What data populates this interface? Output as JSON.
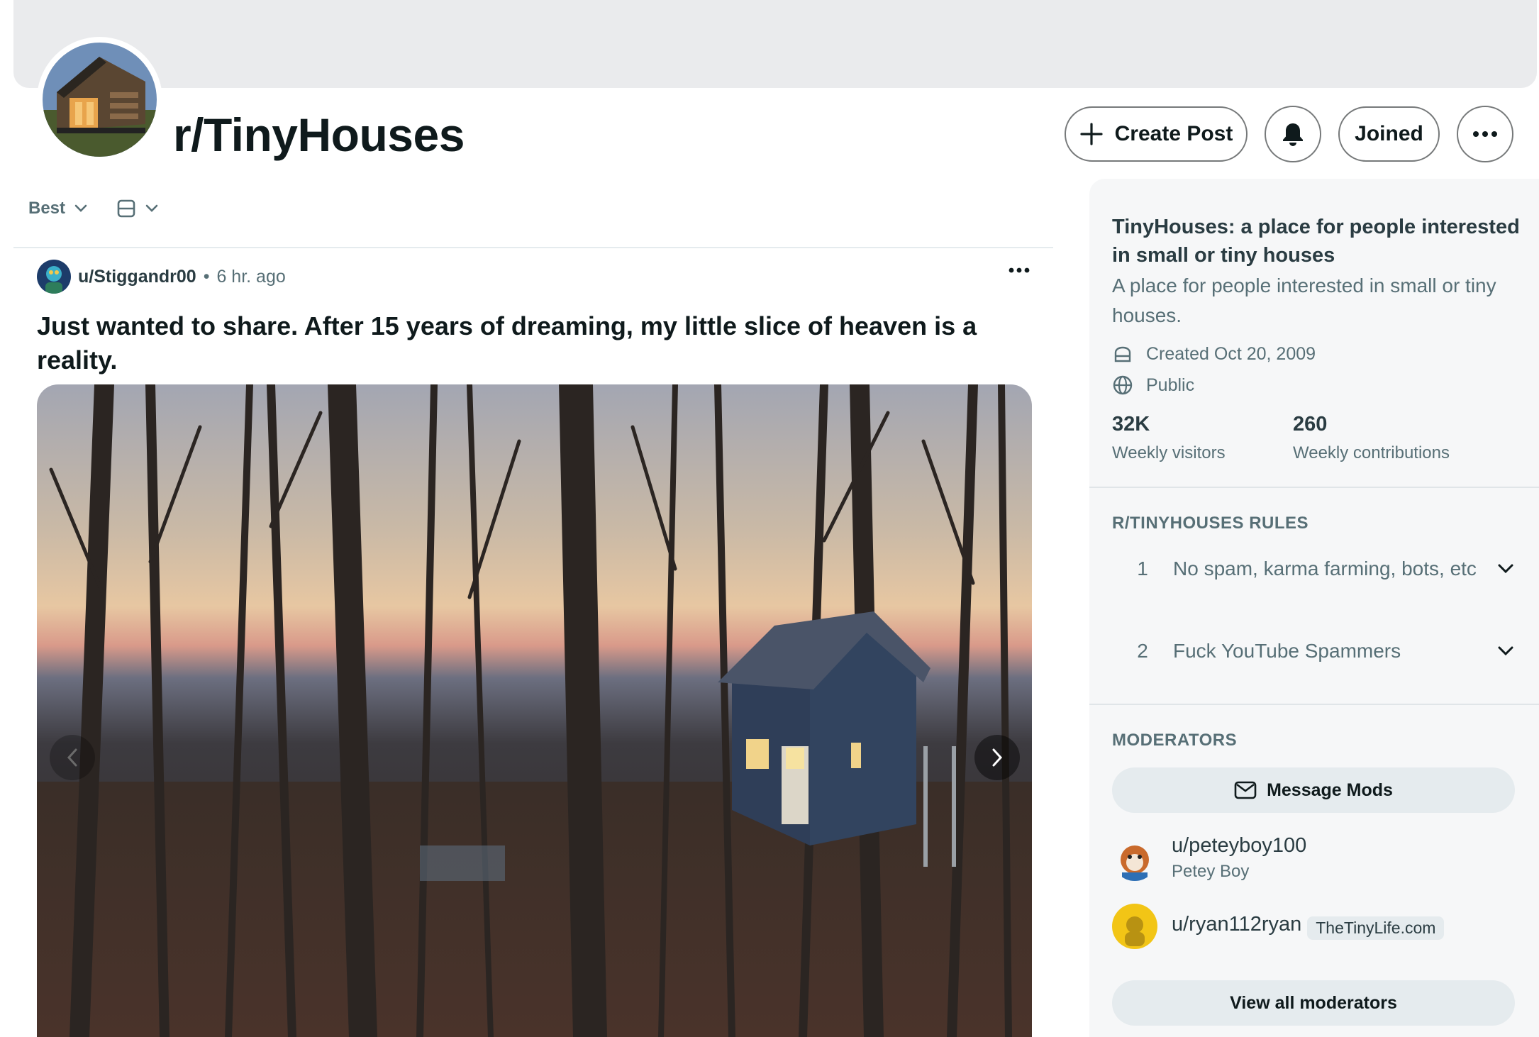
{
  "subreddit": {
    "name": "r/TinyHouses",
    "avatar_icon": "tiny-house-avatar-icon"
  },
  "header_actions": {
    "create_post": "Create Post",
    "notification_icon": "bell-icon",
    "joined": "Joined",
    "more_icon": "more-horizontal-icon"
  },
  "sort": {
    "label": "Best",
    "view_icon": "card-view-icon"
  },
  "post": {
    "author": "u/Stiggandr00",
    "separator": "•",
    "time": "6 hr. ago",
    "title": "Just wanted to share. After 15 years of dreaming, my little slice of heaven is a reality."
  },
  "sidebar": {
    "title": "TinyHouses: a place for people interested in small or tiny houses",
    "description": "A place for people interested in small or tiny houses.",
    "created": "Created Oct 20, 2009",
    "visibility": "Public",
    "stats": [
      {
        "value": "32K",
        "label": "Weekly visitors"
      },
      {
        "value": "260",
        "label": "Weekly contributions"
      }
    ],
    "rules_heading": "R/TINYHOUSES RULES",
    "rules": [
      {
        "num": "1",
        "text": "No spam, karma farming, bots, etc"
      },
      {
        "num": "2",
        "text": "Fuck YouTube Spammers"
      }
    ],
    "moderators_heading": "MODERATORS",
    "message_mods": "Message Mods",
    "moderators": [
      {
        "name": "u/peteyboy100",
        "subtitle": "Petey Boy",
        "flair": ""
      },
      {
        "name": "u/ryan112ryan",
        "subtitle": "",
        "flair": "TheTinyLife.com"
      }
    ],
    "view_all": "View all moderators"
  },
  "colors": {
    "banner": "#eaebed",
    "sidebar_bg": "#f6f7f8",
    "muted_text": "#576f76",
    "strong_text": "#0f1a1c"
  }
}
